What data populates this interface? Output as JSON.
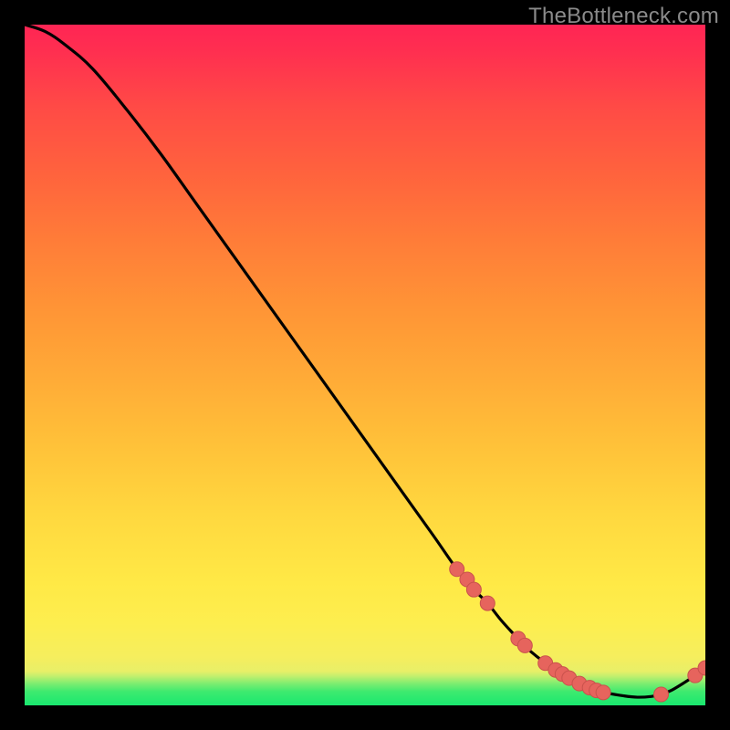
{
  "watermark": "TheBottleneck.com",
  "colors": {
    "line": "#000000",
    "marker_fill": "#e6645d",
    "marker_stroke": "#c9524c",
    "gradient_top": "#ff2554",
    "gradient_bottom": "#19e86f"
  },
  "chart_data": {
    "type": "line",
    "title": "",
    "xlabel": "",
    "ylabel": "",
    "xlim": [
      0,
      100
    ],
    "ylim": [
      0,
      100
    ],
    "grid": false,
    "legend": false,
    "series": [
      {
        "name": "curve",
        "x": [
          0,
          3,
          6,
          10,
          15,
          20,
          25,
          30,
          35,
          40,
          45,
          50,
          55,
          60,
          63.5,
          65,
          66,
          68,
          70,
          72,
          73,
          74,
          76.5,
          78,
          79,
          80,
          81.5,
          83,
          84,
          85,
          88,
          90,
          92,
          93.5,
          95,
          97,
          98.5,
          100
        ],
        "y": [
          100,
          99,
          97,
          93.5,
          87.5,
          81,
          74,
          67,
          60,
          53,
          46,
          39,
          32,
          25,
          20,
          18.5,
          17.0,
          15.0,
          12.5,
          10.3,
          9.2,
          8.2,
          6.2,
          5.2,
          4.6,
          4.0,
          3.2,
          2.6,
          2.2,
          1.9,
          1.4,
          1.2,
          1.3,
          1.6,
          2.2,
          3.4,
          4.4,
          5.5
        ]
      }
    ],
    "markers": [
      {
        "x": 63.5,
        "y": 20.0
      },
      {
        "x": 65.0,
        "y": 18.5
      },
      {
        "x": 66.0,
        "y": 17.0
      },
      {
        "x": 68.0,
        "y": 15.0
      },
      {
        "x": 72.5,
        "y": 9.8
      },
      {
        "x": 73.5,
        "y": 8.8
      },
      {
        "x": 76.5,
        "y": 6.2
      },
      {
        "x": 78.0,
        "y": 5.2
      },
      {
        "x": 79.0,
        "y": 4.6
      },
      {
        "x": 80.0,
        "y": 4.0
      },
      {
        "x": 81.5,
        "y": 3.2
      },
      {
        "x": 83.0,
        "y": 2.6
      },
      {
        "x": 84.0,
        "y": 2.2
      },
      {
        "x": 85.0,
        "y": 1.9
      },
      {
        "x": 93.5,
        "y": 1.6
      },
      {
        "x": 98.5,
        "y": 4.4
      },
      {
        "x": 100.0,
        "y": 5.5
      }
    ]
  }
}
